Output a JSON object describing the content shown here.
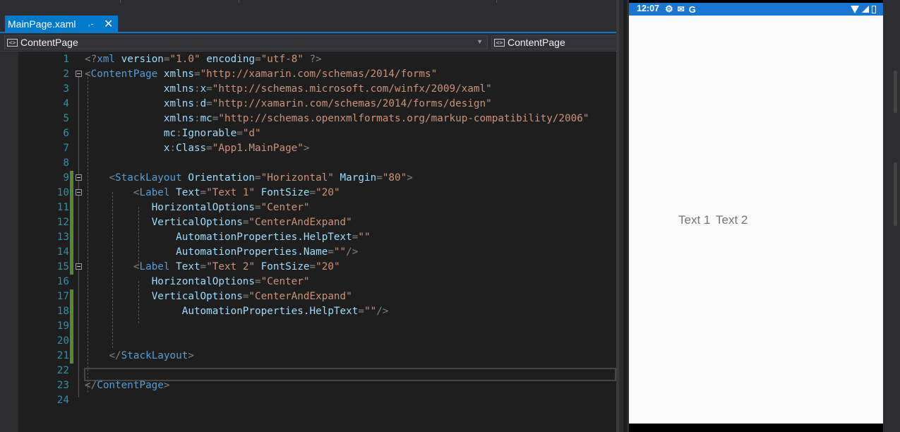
{
  "ide": {
    "tab": {
      "title": "MainPage.xaml",
      "pin_icon": "pin-icon",
      "close_icon": "close-icon"
    },
    "nav": {
      "left": "ContentPage",
      "right": "ContentPage"
    },
    "lines": [
      {
        "n": "1",
        "tokens": [
          [
            "p",
            "<?"
          ],
          [
            "t",
            "xml"
          ],
          [
            "k",
            " "
          ],
          [
            "a",
            "version"
          ],
          [
            "p",
            "="
          ],
          [
            "s",
            "\"1.0\""
          ],
          [
            "k",
            " "
          ],
          [
            "a",
            "encoding"
          ],
          [
            "p",
            "="
          ],
          [
            "s",
            "\"utf-8\""
          ],
          [
            "k",
            " "
          ],
          [
            "p",
            "?>"
          ]
        ]
      },
      {
        "n": "2",
        "tokens": [
          [
            "p",
            "<"
          ],
          [
            "t",
            "ContentPage"
          ],
          [
            "k",
            " "
          ],
          [
            "a",
            "xmlns"
          ],
          [
            "p",
            "="
          ],
          [
            "s",
            "\"http://xamarin.com/schemas/2014/forms\""
          ]
        ]
      },
      {
        "n": "3",
        "tokens": [
          [
            "k",
            "             "
          ],
          [
            "a",
            "xmlns"
          ],
          [
            "p",
            ":"
          ],
          [
            "a",
            "x"
          ],
          [
            "p",
            "="
          ],
          [
            "s",
            "\"http://schemas.microsoft.com/winfx/2009/xaml\""
          ]
        ]
      },
      {
        "n": "4",
        "tokens": [
          [
            "k",
            "             "
          ],
          [
            "a",
            "xmlns"
          ],
          [
            "p",
            ":"
          ],
          [
            "a",
            "d"
          ],
          [
            "p",
            "="
          ],
          [
            "s",
            "\"http://xamarin.com/schemas/2014/forms/design\""
          ]
        ]
      },
      {
        "n": "5",
        "tokens": [
          [
            "k",
            "             "
          ],
          [
            "a",
            "xmlns"
          ],
          [
            "p",
            ":"
          ],
          [
            "a",
            "mc"
          ],
          [
            "p",
            "="
          ],
          [
            "s",
            "\"http://schemas.openxmlformats.org/markup-compatibility/2006\""
          ]
        ]
      },
      {
        "n": "6",
        "tokens": [
          [
            "k",
            "             "
          ],
          [
            "a",
            "mc"
          ],
          [
            "p",
            ":"
          ],
          [
            "a",
            "Ignorable"
          ],
          [
            "p",
            "="
          ],
          [
            "s",
            "\"d\""
          ]
        ]
      },
      {
        "n": "7",
        "tokens": [
          [
            "k",
            "             "
          ],
          [
            "a",
            "x"
          ],
          [
            "p",
            ":"
          ],
          [
            "a",
            "Class"
          ],
          [
            "p",
            "="
          ],
          [
            "s",
            "\"App1.MainPage\""
          ],
          [
            "p",
            ">"
          ]
        ]
      },
      {
        "n": "8",
        "tokens": []
      },
      {
        "n": "9",
        "tokens": [
          [
            "k",
            "    "
          ],
          [
            "p",
            "<"
          ],
          [
            "t",
            "StackLayout"
          ],
          [
            "k",
            " "
          ],
          [
            "a",
            "Orientation"
          ],
          [
            "p",
            "="
          ],
          [
            "s",
            "\"Horizontal\""
          ],
          [
            "k",
            " "
          ],
          [
            "a",
            "Margin"
          ],
          [
            "p",
            "="
          ],
          [
            "s",
            "\"80\""
          ],
          [
            "p",
            ">"
          ]
        ]
      },
      {
        "n": "10",
        "tokens": [
          [
            "k",
            "        "
          ],
          [
            "p",
            "<"
          ],
          [
            "t",
            "Label"
          ],
          [
            "k",
            " "
          ],
          [
            "a",
            "Text"
          ],
          [
            "p",
            "="
          ],
          [
            "s",
            "\"Text 1\""
          ],
          [
            "k",
            " "
          ],
          [
            "a",
            "FontSize"
          ],
          [
            "p",
            "="
          ],
          [
            "s",
            "\"20\""
          ]
        ]
      },
      {
        "n": "11",
        "tokens": [
          [
            "k",
            "           "
          ],
          [
            "a",
            "HorizontalOptions"
          ],
          [
            "p",
            "="
          ],
          [
            "s",
            "\"Center\""
          ]
        ]
      },
      {
        "n": "12",
        "tokens": [
          [
            "k",
            "           "
          ],
          [
            "a",
            "VerticalOptions"
          ],
          [
            "p",
            "="
          ],
          [
            "s",
            "\"CenterAndExpand\""
          ]
        ]
      },
      {
        "n": "13",
        "tokens": [
          [
            "k",
            "               "
          ],
          [
            "a",
            "AutomationProperties.HelpText"
          ],
          [
            "p",
            "="
          ],
          [
            "s",
            "\"\""
          ]
        ]
      },
      {
        "n": "14",
        "tokens": [
          [
            "k",
            "               "
          ],
          [
            "a",
            "AutomationProperties.Name"
          ],
          [
            "p",
            "="
          ],
          [
            "s",
            "\"\""
          ],
          [
            "p",
            "/>"
          ]
        ]
      },
      {
        "n": "15",
        "tokens": [
          [
            "k",
            "        "
          ],
          [
            "p",
            "<"
          ],
          [
            "t",
            "Label"
          ],
          [
            "k",
            " "
          ],
          [
            "a",
            "Text"
          ],
          [
            "p",
            "="
          ],
          [
            "s",
            "\"Text 2\""
          ],
          [
            "k",
            " "
          ],
          [
            "a",
            "FontSize"
          ],
          [
            "p",
            "="
          ],
          [
            "s",
            "\"20\""
          ]
        ]
      },
      {
        "n": "16",
        "tokens": [
          [
            "k",
            "           "
          ],
          [
            "a",
            "HorizontalOptions"
          ],
          [
            "p",
            "="
          ],
          [
            "s",
            "\"Center\""
          ]
        ]
      },
      {
        "n": "17",
        "tokens": [
          [
            "k",
            "           "
          ],
          [
            "a",
            "VerticalOptions"
          ],
          [
            "p",
            "="
          ],
          [
            "s",
            "\"CenterAndExpand\""
          ]
        ]
      },
      {
        "n": "18",
        "tokens": [
          [
            "k",
            "                "
          ],
          [
            "a",
            "AutomationProperties.HelpText"
          ],
          [
            "p",
            "="
          ],
          [
            "s",
            "\"\""
          ],
          [
            "p",
            "/>"
          ]
        ]
      },
      {
        "n": "19",
        "tokens": []
      },
      {
        "n": "20",
        "tokens": []
      },
      {
        "n": "21",
        "tokens": [
          [
            "k",
            "    "
          ],
          [
            "p",
            "</"
          ],
          [
            "t",
            "StackLayout"
          ],
          [
            "p",
            ">"
          ]
        ]
      },
      {
        "n": "22",
        "tokens": []
      },
      {
        "n": "23",
        "tokens": [
          [
            "p",
            "</"
          ],
          [
            "t",
            "ContentPage"
          ],
          [
            "p",
            ">"
          ]
        ]
      },
      {
        "n": "24",
        "tokens": []
      }
    ],
    "changed_lines": [
      "9",
      "10",
      "11",
      "12",
      "13",
      "14",
      "15",
      "17",
      "18",
      "19",
      "20",
      "21"
    ],
    "fold_lines": [
      "2",
      "9",
      "10",
      "15"
    ]
  },
  "phone": {
    "status": {
      "time": "12:07",
      "icons": [
        "settings-icon",
        "mail-icon",
        "google-icon"
      ],
      "right_icons": [
        "wifi-icon",
        "signal-icon",
        "battery-icon"
      ]
    },
    "labels": [
      "Text 1",
      "Text 2"
    ]
  },
  "colors": {
    "accent": "#007acc",
    "status_bar": "#1976d2",
    "tag": "#569cd6",
    "attr": "#9cdcfe",
    "string": "#ce9178",
    "change_bar": "#578a2e"
  }
}
